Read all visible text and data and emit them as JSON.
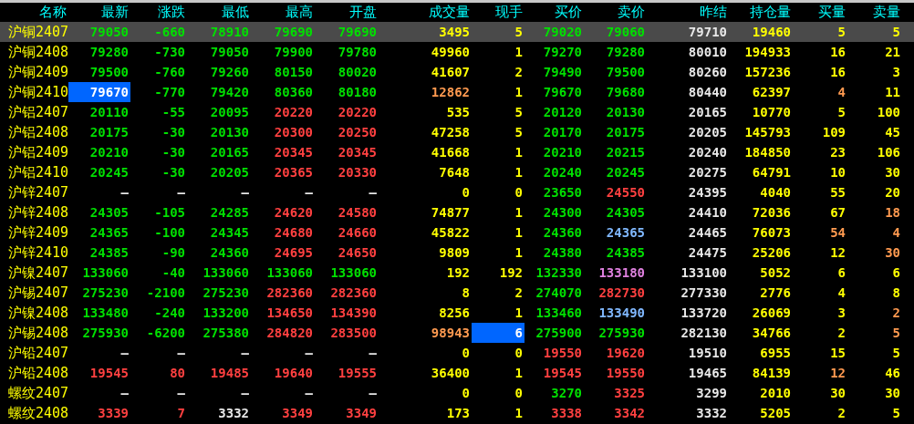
{
  "columns": [
    "名称",
    "最新",
    "涨跌",
    "最低",
    "最高",
    "开盘",
    "成交量",
    "现手",
    "买价",
    "卖价",
    "昨结",
    "持仓量",
    "买量",
    "卖量"
  ],
  "rows": [
    {
      "name": "沪铜2407",
      "selected": true,
      "cells": [
        {
          "text": "79050",
          "color": "#00e000"
        },
        {
          "text": "-660",
          "color": "#00e000"
        },
        {
          "text": "78910",
          "color": "#00e000"
        },
        {
          "text": "79690",
          "color": "#00e000"
        },
        {
          "text": "79690",
          "color": "#00e000"
        },
        {
          "text": "3495",
          "color": "#ffff00"
        },
        {
          "text": "5",
          "color": "#ffff00"
        },
        {
          "text": "79020",
          "color": "#00e000"
        },
        {
          "text": "79060",
          "color": "#00e000"
        },
        {
          "text": "79710",
          "color": "#e8e8e8"
        },
        {
          "text": "19460",
          "color": "#ffff00"
        },
        {
          "text": "5",
          "color": "#ffff00"
        },
        {
          "text": "5",
          "color": "#ffff00"
        }
      ]
    },
    {
      "name": "沪铜2408",
      "selected": false,
      "cells": [
        {
          "text": "79280",
          "color": "#00e000"
        },
        {
          "text": "-730",
          "color": "#00e000"
        },
        {
          "text": "79050",
          "color": "#00e000"
        },
        {
          "text": "79900",
          "color": "#00e000"
        },
        {
          "text": "79780",
          "color": "#00e000"
        },
        {
          "text": "49960",
          "color": "#ffff00"
        },
        {
          "text": "1",
          "color": "#ffff00"
        },
        {
          "text": "79270",
          "color": "#00e000"
        },
        {
          "text": "79280",
          "color": "#00e000"
        },
        {
          "text": "80010",
          "color": "#e8e8e8"
        },
        {
          "text": "194933",
          "color": "#ffff00"
        },
        {
          "text": "16",
          "color": "#ffff00"
        },
        {
          "text": "21",
          "color": "#ffff00"
        }
      ]
    },
    {
      "name": "沪铜2409",
      "selected": false,
      "cells": [
        {
          "text": "79500",
          "color": "#00e000"
        },
        {
          "text": "-760",
          "color": "#00e000"
        },
        {
          "text": "79260",
          "color": "#00e000"
        },
        {
          "text": "80150",
          "color": "#00e000"
        },
        {
          "text": "80020",
          "color": "#00e000"
        },
        {
          "text": "41607",
          "color": "#ffff00"
        },
        {
          "text": "2",
          "color": "#ffff00"
        },
        {
          "text": "79490",
          "color": "#00e000"
        },
        {
          "text": "79500",
          "color": "#00e000"
        },
        {
          "text": "80260",
          "color": "#e8e8e8"
        },
        {
          "text": "157236",
          "color": "#ffff00"
        },
        {
          "text": "16",
          "color": "#ffff00"
        },
        {
          "text": "3",
          "color": "#ffff00"
        }
      ]
    },
    {
      "name": "沪铜2410",
      "selected": false,
      "cells": [
        {
          "text": "79670",
          "color": "#ffffff",
          "highlighted": true
        },
        {
          "text": "-770",
          "color": "#00e000"
        },
        {
          "text": "79420",
          "color": "#00e000"
        },
        {
          "text": "80360",
          "color": "#00e000"
        },
        {
          "text": "80180",
          "color": "#00e000"
        },
        {
          "text": "12862",
          "color": "#ff9a50"
        },
        {
          "text": "1",
          "color": "#ffff00"
        },
        {
          "text": "79670",
          "color": "#00e000"
        },
        {
          "text": "79680",
          "color": "#00e000"
        },
        {
          "text": "80440",
          "color": "#e8e8e8"
        },
        {
          "text": "62397",
          "color": "#ffff00"
        },
        {
          "text": "4",
          "color": "#ff9a50"
        },
        {
          "text": "11",
          "color": "#ffff00"
        }
      ]
    },
    {
      "name": "沪铝2407",
      "selected": false,
      "cells": [
        {
          "text": "20110",
          "color": "#00e000"
        },
        {
          "text": "-55",
          "color": "#00e000"
        },
        {
          "text": "20095",
          "color": "#00e000"
        },
        {
          "text": "20220",
          "color": "#ff4040"
        },
        {
          "text": "20220",
          "color": "#ff4040"
        },
        {
          "text": "535",
          "color": "#ffff00"
        },
        {
          "text": "5",
          "color": "#ffff00"
        },
        {
          "text": "20120",
          "color": "#00e000"
        },
        {
          "text": "20130",
          "color": "#00e000"
        },
        {
          "text": "20165",
          "color": "#e8e8e8"
        },
        {
          "text": "10770",
          "color": "#ffff00"
        },
        {
          "text": "5",
          "color": "#ffff00"
        },
        {
          "text": "100",
          "color": "#ffff00"
        }
      ]
    },
    {
      "name": "沪铝2408",
      "selected": false,
      "cells": [
        {
          "text": "20175",
          "color": "#00e000"
        },
        {
          "text": "-30",
          "color": "#00e000"
        },
        {
          "text": "20130",
          "color": "#00e000"
        },
        {
          "text": "20300",
          "color": "#ff4040"
        },
        {
          "text": "20250",
          "color": "#ff4040"
        },
        {
          "text": "47258",
          "color": "#ffff00"
        },
        {
          "text": "5",
          "color": "#ffff00"
        },
        {
          "text": "20170",
          "color": "#00e000"
        },
        {
          "text": "20175",
          "color": "#00e000"
        },
        {
          "text": "20205",
          "color": "#e8e8e8"
        },
        {
          "text": "145793",
          "color": "#ffff00"
        },
        {
          "text": "109",
          "color": "#ffff00"
        },
        {
          "text": "45",
          "color": "#ffff00"
        }
      ]
    },
    {
      "name": "沪铝2409",
      "selected": false,
      "cells": [
        {
          "text": "20210",
          "color": "#00e000"
        },
        {
          "text": "-30",
          "color": "#00e000"
        },
        {
          "text": "20165",
          "color": "#00e000"
        },
        {
          "text": "20345",
          "color": "#ff4040"
        },
        {
          "text": "20345",
          "color": "#ff4040"
        },
        {
          "text": "41668",
          "color": "#ffff00"
        },
        {
          "text": "1",
          "color": "#ffff00"
        },
        {
          "text": "20210",
          "color": "#00e000"
        },
        {
          "text": "20215",
          "color": "#00e000"
        },
        {
          "text": "20240",
          "color": "#e8e8e8"
        },
        {
          "text": "184850",
          "color": "#ffff00"
        },
        {
          "text": "23",
          "color": "#ffff00"
        },
        {
          "text": "106",
          "color": "#ffff00"
        }
      ]
    },
    {
      "name": "沪铝2410",
      "selected": false,
      "cells": [
        {
          "text": "20245",
          "color": "#00e000"
        },
        {
          "text": "-30",
          "color": "#00e000"
        },
        {
          "text": "20205",
          "color": "#00e000"
        },
        {
          "text": "20365",
          "color": "#ff4040"
        },
        {
          "text": "20330",
          "color": "#ff4040"
        },
        {
          "text": "7648",
          "color": "#ffff00"
        },
        {
          "text": "1",
          "color": "#ffff00"
        },
        {
          "text": "20240",
          "color": "#00e000"
        },
        {
          "text": "20245",
          "color": "#00e000"
        },
        {
          "text": "20275",
          "color": "#e8e8e8"
        },
        {
          "text": "64791",
          "color": "#ffff00"
        },
        {
          "text": "10",
          "color": "#ffff00"
        },
        {
          "text": "30",
          "color": "#ffff00"
        }
      ]
    },
    {
      "name": "沪锌2407",
      "selected": false,
      "cells": [
        {
          "text": "—",
          "color": "#e8e8e8"
        },
        {
          "text": "—",
          "color": "#e8e8e8"
        },
        {
          "text": "—",
          "color": "#e8e8e8"
        },
        {
          "text": "—",
          "color": "#e8e8e8"
        },
        {
          "text": "—",
          "color": "#e8e8e8"
        },
        {
          "text": "0",
          "color": "#ffff00"
        },
        {
          "text": "0",
          "color": "#ffff00"
        },
        {
          "text": "23650",
          "color": "#00e000"
        },
        {
          "text": "24550",
          "color": "#ff4040"
        },
        {
          "text": "24395",
          "color": "#e8e8e8"
        },
        {
          "text": "4040",
          "color": "#ffff00"
        },
        {
          "text": "55",
          "color": "#ffff00"
        },
        {
          "text": "20",
          "color": "#ffff00"
        }
      ]
    },
    {
      "name": "沪锌2408",
      "selected": false,
      "cells": [
        {
          "text": "24305",
          "color": "#00e000"
        },
        {
          "text": "-105",
          "color": "#00e000"
        },
        {
          "text": "24285",
          "color": "#00e000"
        },
        {
          "text": "24620",
          "color": "#ff4040"
        },
        {
          "text": "24580",
          "color": "#ff4040"
        },
        {
          "text": "74877",
          "color": "#ffff00"
        },
        {
          "text": "1",
          "color": "#ffff00"
        },
        {
          "text": "24300",
          "color": "#00e000"
        },
        {
          "text": "24305",
          "color": "#00e000"
        },
        {
          "text": "24410",
          "color": "#e8e8e8"
        },
        {
          "text": "72036",
          "color": "#ffff00"
        },
        {
          "text": "67",
          "color": "#ffff00"
        },
        {
          "text": "18",
          "color": "#ff9a50"
        }
      ]
    },
    {
      "name": "沪锌2409",
      "selected": false,
      "cells": [
        {
          "text": "24365",
          "color": "#00e000"
        },
        {
          "text": "-100",
          "color": "#00e000"
        },
        {
          "text": "24345",
          "color": "#00e000"
        },
        {
          "text": "24680",
          "color": "#ff4040"
        },
        {
          "text": "24660",
          "color": "#ff4040"
        },
        {
          "text": "45822",
          "color": "#ffff00"
        },
        {
          "text": "1",
          "color": "#ffff00"
        },
        {
          "text": "24360",
          "color": "#00e000"
        },
        {
          "text": "24365",
          "color": "#80b8ff"
        },
        {
          "text": "24465",
          "color": "#e8e8e8"
        },
        {
          "text": "76073",
          "color": "#ffff00"
        },
        {
          "text": "54",
          "color": "#ff9a50"
        },
        {
          "text": "4",
          "color": "#ff9a50"
        }
      ]
    },
    {
      "name": "沪锌2410",
      "selected": false,
      "cells": [
        {
          "text": "24385",
          "color": "#00e000"
        },
        {
          "text": "-90",
          "color": "#00e000"
        },
        {
          "text": "24360",
          "color": "#00e000"
        },
        {
          "text": "24695",
          "color": "#ff4040"
        },
        {
          "text": "24650",
          "color": "#ff4040"
        },
        {
          "text": "9809",
          "color": "#ffff00"
        },
        {
          "text": "1",
          "color": "#ffff00"
        },
        {
          "text": "24380",
          "color": "#00e000"
        },
        {
          "text": "24385",
          "color": "#00e000"
        },
        {
          "text": "24475",
          "color": "#e8e8e8"
        },
        {
          "text": "25206",
          "color": "#ffff00"
        },
        {
          "text": "12",
          "color": "#ffff00"
        },
        {
          "text": "30",
          "color": "#ff9a50"
        }
      ]
    },
    {
      "name": "沪镍2407",
      "selected": false,
      "cells": [
        {
          "text": "133060",
          "color": "#00e000"
        },
        {
          "text": "-40",
          "color": "#00e000"
        },
        {
          "text": "133060",
          "color": "#00e000"
        },
        {
          "text": "133060",
          "color": "#00e000"
        },
        {
          "text": "133060",
          "color": "#00e000"
        },
        {
          "text": "192",
          "color": "#ffff00"
        },
        {
          "text": "192",
          "color": "#ffff00"
        },
        {
          "text": "132330",
          "color": "#00e000"
        },
        {
          "text": "133180",
          "color": "#e080e0"
        },
        {
          "text": "133100",
          "color": "#e8e8e8"
        },
        {
          "text": "5052",
          "color": "#ffff00"
        },
        {
          "text": "6",
          "color": "#ffff00"
        },
        {
          "text": "6",
          "color": "#ffff00"
        }
      ]
    },
    {
      "name": "沪锡2407",
      "selected": false,
      "cells": [
        {
          "text": "275230",
          "color": "#00e000"
        },
        {
          "text": "-2100",
          "color": "#00e000"
        },
        {
          "text": "275230",
          "color": "#00e000"
        },
        {
          "text": "282360",
          "color": "#ff4040"
        },
        {
          "text": "282360",
          "color": "#ff4040"
        },
        {
          "text": "8",
          "color": "#ffff00"
        },
        {
          "text": "2",
          "color": "#ffff00"
        },
        {
          "text": "274070",
          "color": "#00e000"
        },
        {
          "text": "282730",
          "color": "#ff4040"
        },
        {
          "text": "277330",
          "color": "#e8e8e8"
        },
        {
          "text": "2776",
          "color": "#ffff00"
        },
        {
          "text": "4",
          "color": "#ffff00"
        },
        {
          "text": "8",
          "color": "#ffff00"
        }
      ]
    },
    {
      "name": "沪镍2408",
      "selected": false,
      "cells": [
        {
          "text": "133480",
          "color": "#00e000"
        },
        {
          "text": "-240",
          "color": "#00e000"
        },
        {
          "text": "133200",
          "color": "#00e000"
        },
        {
          "text": "134650",
          "color": "#ff4040"
        },
        {
          "text": "134390",
          "color": "#ff4040"
        },
        {
          "text": "8256",
          "color": "#ffff00"
        },
        {
          "text": "1",
          "color": "#ffff00"
        },
        {
          "text": "133460",
          "color": "#00e000"
        },
        {
          "text": "133490",
          "color": "#80b8ff"
        },
        {
          "text": "133720",
          "color": "#e8e8e8"
        },
        {
          "text": "26069",
          "color": "#ffff00"
        },
        {
          "text": "3",
          "color": "#ffff00"
        },
        {
          "text": "2",
          "color": "#ff9a50"
        }
      ]
    },
    {
      "name": "沪锡2408",
      "selected": false,
      "cells": [
        {
          "text": "275930",
          "color": "#00e000"
        },
        {
          "text": "-6200",
          "color": "#00e000"
        },
        {
          "text": "275380",
          "color": "#00e000"
        },
        {
          "text": "284820",
          "color": "#ff4040"
        },
        {
          "text": "283500",
          "color": "#ff4040"
        },
        {
          "text": "98943",
          "color": "#ff9a50"
        },
        {
          "text": "6",
          "color": "#ffffff",
          "highlighted": true
        },
        {
          "text": "275900",
          "color": "#00e000"
        },
        {
          "text": "275930",
          "color": "#00e000"
        },
        {
          "text": "282130",
          "color": "#e8e8e8"
        },
        {
          "text": "34766",
          "color": "#ffff00"
        },
        {
          "text": "2",
          "color": "#ffff00"
        },
        {
          "text": "5",
          "color": "#ff9a50"
        }
      ]
    },
    {
      "name": "沪铅2407",
      "selected": false,
      "cells": [
        {
          "text": "—",
          "color": "#e8e8e8"
        },
        {
          "text": "—",
          "color": "#e8e8e8"
        },
        {
          "text": "—",
          "color": "#e8e8e8"
        },
        {
          "text": "—",
          "color": "#e8e8e8"
        },
        {
          "text": "—",
          "color": "#e8e8e8"
        },
        {
          "text": "0",
          "color": "#ffff00"
        },
        {
          "text": "0",
          "color": "#ffff00"
        },
        {
          "text": "19550",
          "color": "#ff4040"
        },
        {
          "text": "19620",
          "color": "#ff4040"
        },
        {
          "text": "19510",
          "color": "#e8e8e8"
        },
        {
          "text": "6955",
          "color": "#ffff00"
        },
        {
          "text": "15",
          "color": "#ffff00"
        },
        {
          "text": "5",
          "color": "#ffff00"
        }
      ]
    },
    {
      "name": "沪铅2408",
      "selected": false,
      "cells": [
        {
          "text": "19545",
          "color": "#ff4040"
        },
        {
          "text": "80",
          "color": "#ff4040"
        },
        {
          "text": "19485",
          "color": "#ff4040"
        },
        {
          "text": "19640",
          "color": "#ff4040"
        },
        {
          "text": "19555",
          "color": "#ff4040"
        },
        {
          "text": "36400",
          "color": "#ffff00"
        },
        {
          "text": "1",
          "color": "#ffff00"
        },
        {
          "text": "19545",
          "color": "#ff4040"
        },
        {
          "text": "19550",
          "color": "#ff4040"
        },
        {
          "text": "19465",
          "color": "#e8e8e8"
        },
        {
          "text": "84139",
          "color": "#ffff00"
        },
        {
          "text": "12",
          "color": "#ff9a50"
        },
        {
          "text": "46",
          "color": "#ffff00"
        }
      ]
    },
    {
      "name": "螺纹2407",
      "selected": false,
      "cells": [
        {
          "text": "—",
          "color": "#e8e8e8"
        },
        {
          "text": "—",
          "color": "#e8e8e8"
        },
        {
          "text": "—",
          "color": "#e8e8e8"
        },
        {
          "text": "—",
          "color": "#e8e8e8"
        },
        {
          "text": "—",
          "color": "#e8e8e8"
        },
        {
          "text": "0",
          "color": "#ffff00"
        },
        {
          "text": "0",
          "color": "#ffff00"
        },
        {
          "text": "3270",
          "color": "#00e000"
        },
        {
          "text": "3325",
          "color": "#ff4040"
        },
        {
          "text": "3299",
          "color": "#e8e8e8"
        },
        {
          "text": "2010",
          "color": "#ffff00"
        },
        {
          "text": "30",
          "color": "#ffff00"
        },
        {
          "text": "30",
          "color": "#ffff00"
        }
      ]
    },
    {
      "name": "螺纹2408",
      "selected": false,
      "cells": [
        {
          "text": "3339",
          "color": "#ff4040"
        },
        {
          "text": "7",
          "color": "#ff4040"
        },
        {
          "text": "3332",
          "color": "#e8e8e8"
        },
        {
          "text": "3349",
          "color": "#ff4040"
        },
        {
          "text": "3349",
          "color": "#ff4040"
        },
        {
          "text": "173",
          "color": "#ffff00"
        },
        {
          "text": "1",
          "color": "#ffff00"
        },
        {
          "text": "3338",
          "color": "#ff4040"
        },
        {
          "text": "3342",
          "color": "#ff4040"
        },
        {
          "text": "3332",
          "color": "#e8e8e8"
        },
        {
          "text": "5205",
          "color": "#ffff00"
        },
        {
          "text": "2",
          "color": "#ffff00"
        },
        {
          "text": "5",
          "color": "#ffff00"
        }
      ]
    }
  ]
}
